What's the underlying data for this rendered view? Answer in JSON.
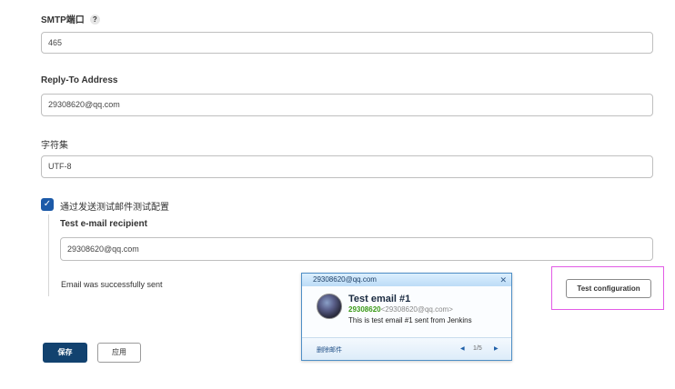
{
  "fields": {
    "smtp_port": {
      "label": "SMTP端口",
      "help": "?",
      "value": "465"
    },
    "reply_to": {
      "label": "Reply-To Address",
      "value": "29308620@qq.com"
    },
    "charset": {
      "label": "字符集",
      "value": "UTF-8"
    }
  },
  "test_mail": {
    "checkbox_label": "通过发送测试邮件测试配置",
    "checkbox_mark": "✓",
    "recipient_label": "Test e-mail recipient",
    "recipient_value": "29308620@qq.com",
    "status": "Email was successfully sent",
    "button": "Test configuration"
  },
  "buttons": {
    "save": "保存",
    "apply": "应用"
  },
  "notification": {
    "header": "29308620@qq.com",
    "close": "✕",
    "title": "Test email #1",
    "sender_name": "29308620",
    "sender_email": "<29308620@qq.com>",
    "body": "This is test email #1 sent from Jenkins",
    "delete": "删除邮件",
    "prev": "◀",
    "pager": "1/5",
    "next": "▶"
  },
  "colors": {
    "primary_button": "#12426f",
    "checkbox": "#1c5aa8",
    "highlight": "#e25be6",
    "sender_green": "#3a9a16"
  }
}
